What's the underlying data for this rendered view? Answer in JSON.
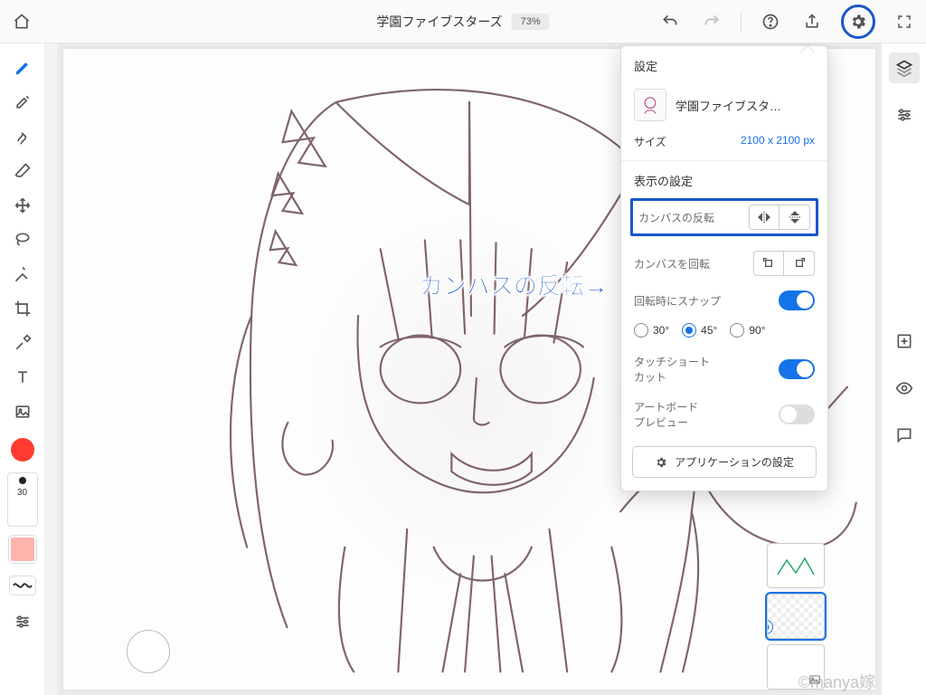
{
  "header": {
    "title": "学園ファイブスターズ",
    "zoom": "73%",
    "icons": {
      "home": "home-icon",
      "undo": "undo-icon",
      "redo": "redo-icon",
      "help": "help-icon",
      "share": "share-icon",
      "gear": "gear-icon",
      "fullscreen": "fullscreen-icon"
    }
  },
  "left_tools": {
    "items": [
      "brush",
      "paintbrush",
      "smudge",
      "eraser",
      "transform",
      "lasso",
      "fill",
      "crop",
      "eyedropper",
      "text",
      "image"
    ],
    "brush_size": "30"
  },
  "colors": {
    "foreground": "#ff3b30",
    "tint_preview": "#ffb3ad",
    "canvas_indicator": "#ffffff"
  },
  "right_tools": {
    "items": [
      "layers",
      "adjustments",
      "precision",
      "add-panel",
      "visibility",
      "comments"
    ]
  },
  "settings_panel": {
    "title": "設定",
    "doc_name": "学園ファイブスタ…",
    "size_label": "サイズ",
    "size_value": "2100 x 2100 px",
    "section_view": "表示の設定",
    "flip_label": "カンバスの反転",
    "rotate_label": "カンバスを回転",
    "snap_label": "回転時にスナップ",
    "snap_on": true,
    "angles": {
      "a30": "30°",
      "a45": "45°",
      "a90": "90°",
      "selected": "45"
    },
    "touch_shortcut_label": "タッチショート\nカット",
    "touch_shortcut_on": true,
    "artboard_preview_label": "アートボード\nプレビュー",
    "artboard_preview_on": false,
    "app_settings_label": "アプリケーションの設定"
  },
  "annotation": {
    "text": "カンバスの反転→"
  },
  "watermark": "©manya嫁",
  "layers": {
    "count": 3
  }
}
